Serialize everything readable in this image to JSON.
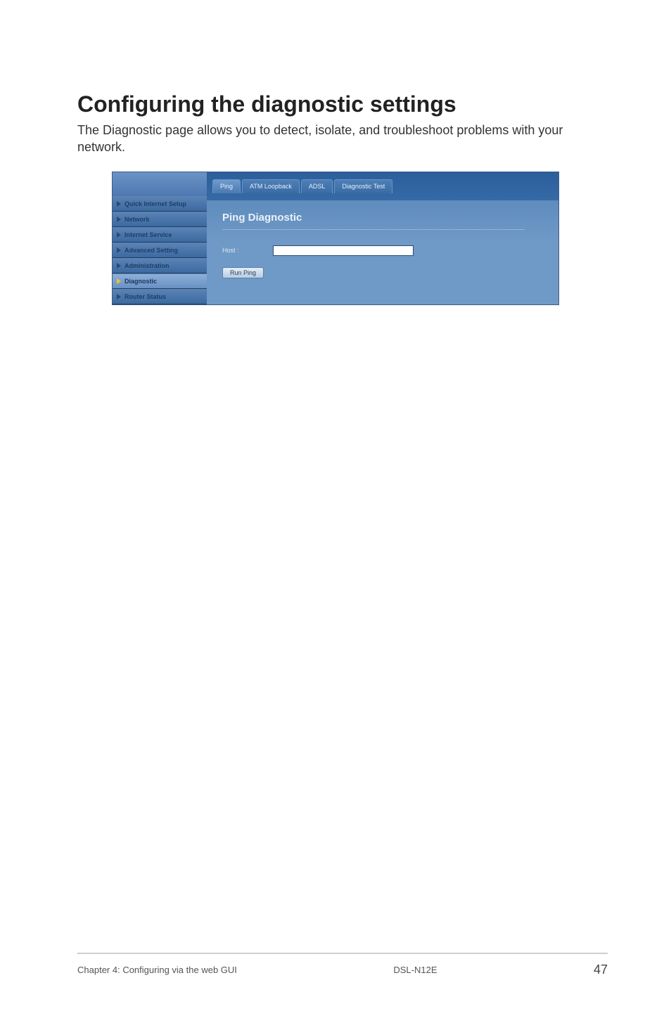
{
  "heading": "Configuring the diagnostic settings",
  "description": "The Diagnostic page allows you to detect, isolate, and troubleshoot problems with your network.",
  "router": {
    "sidebar": {
      "items": [
        {
          "label": "Quick Internet Setup",
          "active": false
        },
        {
          "label": "Network",
          "active": false
        },
        {
          "label": "Internet Service",
          "active": false
        },
        {
          "label": "Advanced Setting",
          "active": false
        },
        {
          "label": "Administration",
          "active": false
        },
        {
          "label": "Diagnostic",
          "active": true
        },
        {
          "label": "Router Status",
          "active": false
        }
      ]
    },
    "tabs": [
      {
        "label": "Ping",
        "active": true
      },
      {
        "label": "ATM Loopback",
        "active": false
      },
      {
        "label": "ADSL",
        "active": false
      },
      {
        "label": "Diagnostic Test",
        "active": false
      }
    ],
    "panel": {
      "title": "Ping Diagnostic",
      "host_label": "Host :",
      "host_value": "",
      "run_button": "Run Ping"
    }
  },
  "footer": {
    "left": "Chapter 4: Configuring via the web GUI",
    "right": "DSL-N12E",
    "page": "47"
  }
}
